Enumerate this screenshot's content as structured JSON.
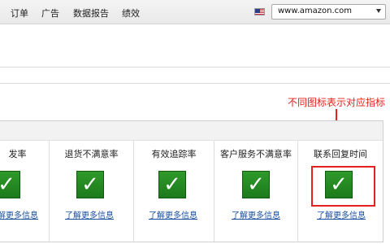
{
  "nav": {
    "items": [
      {
        "label": "订单"
      },
      {
        "label": "广告"
      },
      {
        "label": "数据报告"
      },
      {
        "label": "绩效"
      }
    ],
    "market_selector": {
      "value": "www.amazon.com",
      "flag_icon": "us-flag-icon"
    }
  },
  "annotation": {
    "text": "不同图标表示对应指标",
    "color": "#e4211c"
  },
  "metrics": [
    {
      "title": "发率",
      "status_icon": "check-icon",
      "link": "了解更多信息"
    },
    {
      "title": "退货不满意率",
      "status_icon": "check-icon",
      "link": "了解更多信息"
    },
    {
      "title": "有效追踪率",
      "status_icon": "check-icon",
      "link": "了解更多信息"
    },
    {
      "title": "客户服务不满意率",
      "status_icon": "check-icon",
      "link": "了解更多信息"
    },
    {
      "title": "联系回复时间",
      "status_icon": "check-icon",
      "link": "了解更多信息"
    }
  ],
  "colors": {
    "ok_green": "#1f8a1d",
    "link_blue": "#1a4fa0",
    "highlight_red": "#e4211c"
  }
}
